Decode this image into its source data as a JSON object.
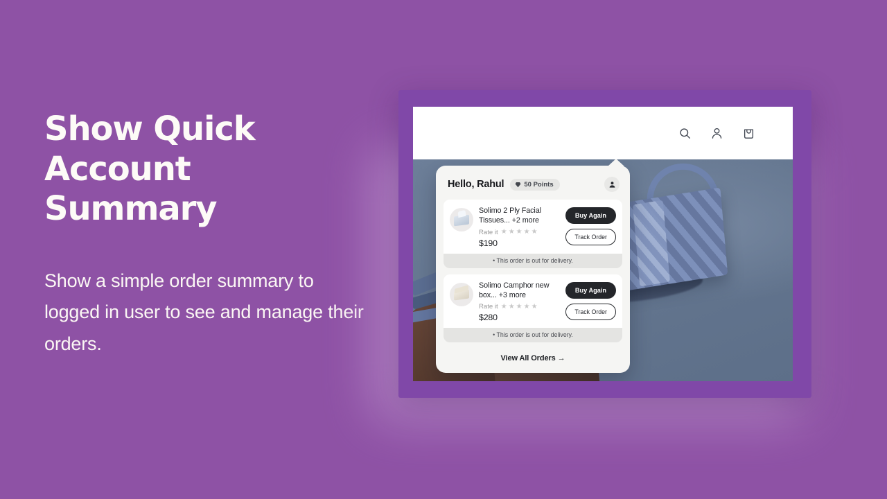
{
  "slide": {
    "headline_line1": "Show Quick",
    "headline_line2": "Account Summary",
    "subcopy": "Show a simple order summary to logged in user to see and manage their orders.",
    "background_color": "#8e52a5",
    "frame_color": "#8048a8"
  },
  "storefront": {
    "nav": {
      "search_icon": "search-icon",
      "account_icon": "person-icon",
      "cart_icon": "shopping-bag-icon"
    }
  },
  "popover": {
    "greeting_prefix": "Hello, ",
    "user_name": "Rahul",
    "points_badge": {
      "icon": "diamond-icon",
      "label": "50 Points"
    },
    "avatar_icon": "person-icon",
    "view_all_label": "View All Orders →",
    "orders": [
      {
        "thumb": "tissue-box-thumbnail",
        "title": "Solimo 2 Ply Facial Tissues... +2 more",
        "rate_label": "Rate it",
        "stars": 5,
        "rating": 0,
        "price": "$190",
        "buy_label": "Buy Again",
        "track_label": "Track Order",
        "status": "• This order is out for delivery."
      },
      {
        "thumb": "camphor-box-thumbnail",
        "title": "Solimo Camphor new box... +3 more",
        "rate_label": "Rate it",
        "stars": 5,
        "rating": 0,
        "price": "$280",
        "buy_label": "Buy Again",
        "track_label": "Track Order",
        "status": "• This order is out for delivery."
      }
    ]
  }
}
